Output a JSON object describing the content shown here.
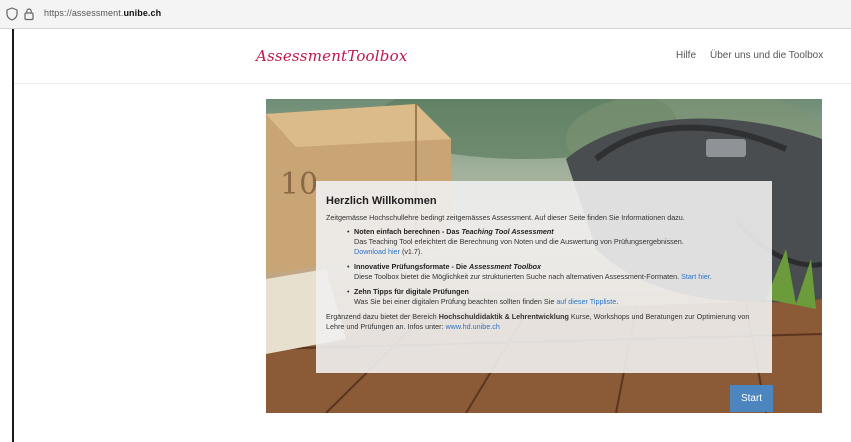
{
  "browser": {
    "url_prefix": "https://assessment.",
    "url_domain": "unibe.ch"
  },
  "header": {
    "logo": "AssessmentToolbox",
    "nav": [
      {
        "label": "Hilfe"
      },
      {
        "label": "Über uns und die Toolbox"
      }
    ]
  },
  "welcome": {
    "title": "Herzlich Willkommen",
    "intro": "Zeitgemässe Hochschullehre bedingt zeitgemässes Assessment. Auf dieser Seite finden Sie Informationen dazu.",
    "items": [
      {
        "head_prefix": "Noten einfach berechnen - Das ",
        "head_em": "Teaching Tool Assessment",
        "text": "Das Teaching Tool erleichtert die Berechnung von Noten und die Auswertung von Prüfungsergebnissen.",
        "link": "Download hier",
        "after_link": " (v1.7)."
      },
      {
        "head_prefix": "Innovative Prüfungsformate - Die ",
        "head_em": "Assessment Toolbox",
        "text": "Diese Toolbox bietet die Möglichkeit zur strukturierten Suche nach alternativen Assessment-Formaten. ",
        "link": "Start hier",
        "after_link": "."
      },
      {
        "head_prefix": "Zehn Tipps für digitale Prüfungen",
        "head_em": "",
        "text": "Was Sie bei einer digitalen Prüfung beachten sollten finden Sie ",
        "link": "auf dieser Tippliste",
        "after_link": "."
      }
    ],
    "footer_pre": "Ergänzend dazu bietet der Bereich ",
    "footer_bold": "Hochschuldidaktik & Lehrentwicklung",
    "footer_post": " Kurse, Workshops und Beratungen zur Optimierung von Lehre und Prüfungen an. Infos unter: ",
    "footer_link": "www.hd.unibe.ch"
  },
  "start_button": "Start",
  "hero_image": {
    "alt_text": "10",
    "colors": {
      "box": "#c9a475",
      "bag": "#4a4d50",
      "table": "#8b5a36"
    }
  },
  "icons": {
    "shield": "shield-icon",
    "lock": "lock-icon"
  }
}
